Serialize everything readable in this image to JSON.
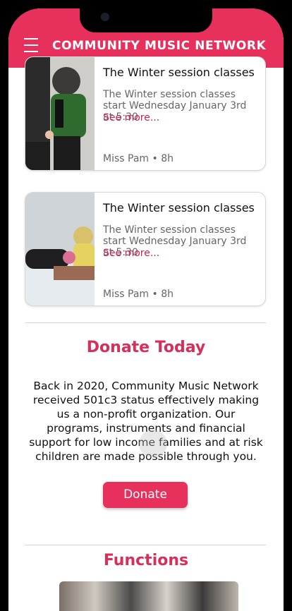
{
  "app": {
    "title": "COMMUNITY MUSIC NETWORK",
    "menu_icon": "hamburger-menu-icon",
    "brand_color": "#e8305c"
  },
  "cards": [
    {
      "title": "The Winter session classes",
      "body": "The Winter session classes start Wednesday January 3rd at 5:30",
      "more": "See more...",
      "meta": "Miss Pam • 8h",
      "image": "child-playing-piano-in-snow"
    },
    {
      "title": "The Winter session classes",
      "body": "The Winter session classes start Wednesday January 3rd at 5:30",
      "more": "See more...",
      "meta": "Miss Pam • 8h",
      "image": "children-in-winter-snow"
    }
  ],
  "donate": {
    "heading": "Donate Today",
    "text": "Back in 2020, Community Music Network received 501c3 status effectively making us a non-profit organization. Our programs, instruments and financial support for low income families and at risk children are made possible through you.",
    "button": "Donate"
  },
  "functions": {
    "heading": "Functions",
    "image": "wedding-party-group-photo"
  }
}
